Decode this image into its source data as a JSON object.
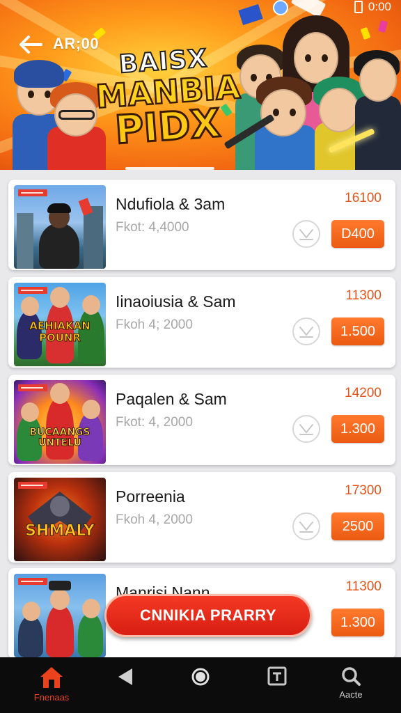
{
  "status": {
    "time": "0:00"
  },
  "header": {
    "back_label": "AR;00",
    "logo_lines": [
      "BAISX",
      "MANBIA",
      "PIDX"
    ]
  },
  "items": [
    {
      "title": "Ndufiola & 3am",
      "subtitle": "Fkot: 4,4000",
      "points": "16100",
      "price": "D400"
    },
    {
      "title": "Iinaoiusia & Sam",
      "subtitle": "Fkoh 4; 2000",
      "points": "11300",
      "price": "1.500"
    },
    {
      "title": "Paqalen & Sam",
      "subtitle": "Fkot: 4, 2000",
      "points": "14200",
      "price": "1.300"
    },
    {
      "title": "Porreenia",
      "subtitle": "Fkoh 4, 2000",
      "points": "17300",
      "price": "2500"
    },
    {
      "title": "Manrisi Nann",
      "subtitle": "",
      "points": "11300",
      "price": "1.300"
    }
  ],
  "thumb_texts": [
    "",
    "AEHIAKAN POUNR",
    "BUCAANGS UNTELU",
    "SHMALY",
    ""
  ],
  "cta": {
    "label": "CNNIKIA PRARRY"
  },
  "nav": {
    "items": [
      {
        "icon": "home-icon",
        "label": "Fnenaas",
        "active": true
      },
      {
        "icon": "back-triangle-icon",
        "label": ""
      },
      {
        "icon": "circle-home-icon",
        "label": ""
      },
      {
        "icon": "recents-icon",
        "label": ""
      },
      {
        "icon": "search-icon",
        "label": "Aacte"
      }
    ]
  },
  "colors": {
    "accent": "#ec5a12",
    "cta": "#d81e12",
    "points": "#e4541b"
  }
}
